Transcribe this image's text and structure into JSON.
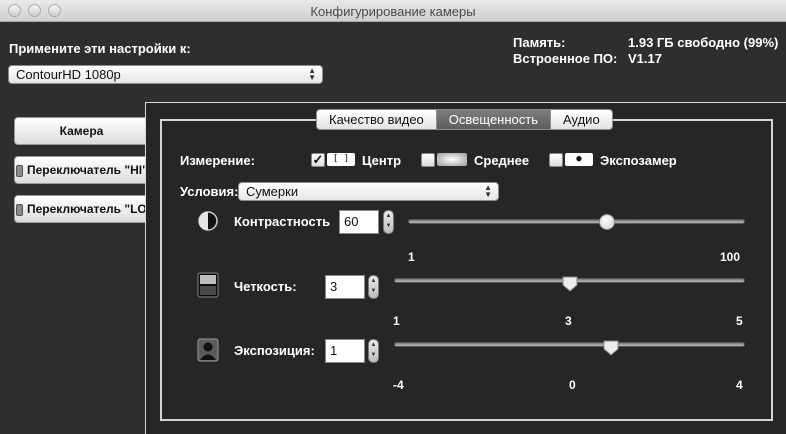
{
  "window": {
    "title": "Конфигурирование камеры"
  },
  "apply": {
    "label": "Примените эти настройки к:",
    "device": "ContourHD 1080p"
  },
  "info": {
    "memory_label": "Память:",
    "memory_value": "1.93 ГБ свободно (99%)",
    "firmware_label": "Встроенное ПО:",
    "firmware_value": "V1.17"
  },
  "sidebar": {
    "items": [
      {
        "label": "Камера"
      },
      {
        "label": "Переключатель \"HI\""
      },
      {
        "label": "Переключатель \"LO\""
      }
    ]
  },
  "tabs": [
    {
      "label": "Качество видео"
    },
    {
      "label": "Освещенность"
    },
    {
      "label": "Аудио"
    }
  ],
  "metering": {
    "label": "Измерение:",
    "options": [
      {
        "label": "Центр",
        "checked": true,
        "icon": "center-weighted-icon",
        "glyph": "[ ]"
      },
      {
        "label": "Среднее",
        "checked": false,
        "icon": "average-meter-icon",
        "glyph": ""
      },
      {
        "label": "Экспозамер",
        "checked": false,
        "icon": "spot-meter-icon",
        "glyph": "●"
      }
    ]
  },
  "conditions": {
    "label": "Условия:",
    "value": "Сумерки"
  },
  "contrast": {
    "label": "Контрастность",
    "value": "60",
    "min": "1",
    "max": "100",
    "min_val": 1,
    "max_val": 100,
    "icon": "contrast-icon"
  },
  "sharpness": {
    "label": "Четкость:",
    "value": "3",
    "min": "1",
    "mid": "3",
    "max": "5",
    "min_val": 1,
    "max_val": 5,
    "icon": "sharpness-icon"
  },
  "exposure": {
    "label": "Экспозиция:",
    "value": "1",
    "min": "-4",
    "mid": "0",
    "max": "4",
    "min_val": -4,
    "max_val": 4,
    "icon": "exposure-person-icon"
  }
}
